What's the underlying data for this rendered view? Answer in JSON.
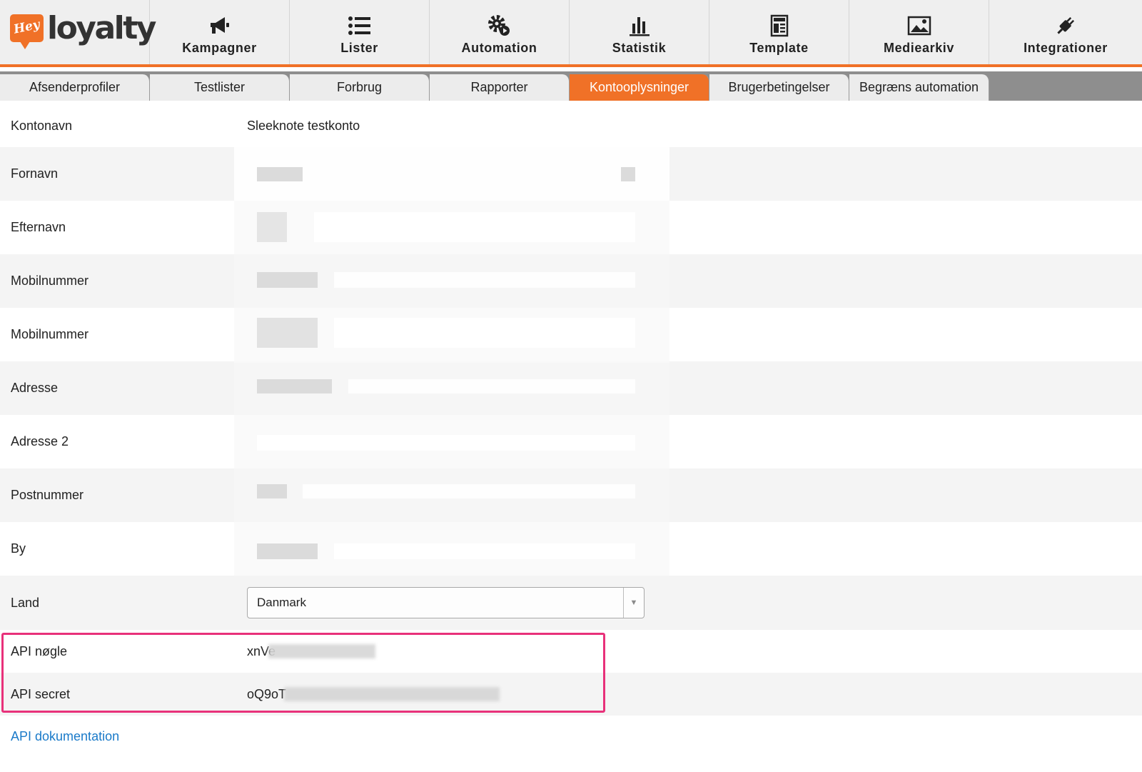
{
  "brand": {
    "logo_badge": "Hey",
    "logo_word": "loyalty",
    "accent": "#f07127",
    "highlight": "#e8317a",
    "link": "#1a7ac9"
  },
  "nav": [
    {
      "label": "Kampagner",
      "icon": "megaphone-icon"
    },
    {
      "label": "Lister",
      "icon": "list-icon"
    },
    {
      "label": "Automation",
      "icon": "gear-play-icon"
    },
    {
      "label": "Statistik",
      "icon": "bar-chart-icon"
    },
    {
      "label": "Template",
      "icon": "template-icon"
    },
    {
      "label": "Mediearkiv",
      "icon": "image-icon"
    },
    {
      "label": "Integrationer",
      "icon": "plug-icon"
    }
  ],
  "subtabs": [
    {
      "label": "Afsenderprofiler",
      "active": false
    },
    {
      "label": "Testlister",
      "active": false
    },
    {
      "label": "Forbrug",
      "active": false
    },
    {
      "label": "Rapporter",
      "active": false
    },
    {
      "label": "Kontooplysninger",
      "active": true
    },
    {
      "label": "Brugerbetingelser",
      "active": false
    },
    {
      "label": "Begræns automation",
      "active": false
    }
  ],
  "account": {
    "kontonavn_label": "Kontonavn",
    "kontonavn_value": "Sleeknote testkonto",
    "fields": [
      {
        "label": "Fornavn"
      },
      {
        "label": "Efternavn"
      },
      {
        "label": "Mobilnummer"
      },
      {
        "label": "Mobilnummer"
      },
      {
        "label": "Adresse"
      },
      {
        "label": "Adresse 2"
      },
      {
        "label": "Postnummer"
      },
      {
        "label": "By"
      }
    ],
    "land_label": "Land",
    "land_value": "Danmark"
  },
  "api": {
    "key_label": "API nøgle",
    "key_value_visible": "xnVe",
    "secret_label": "API secret",
    "secret_value_visible": "oQ9oT",
    "doc_link": "API dokumentation"
  }
}
